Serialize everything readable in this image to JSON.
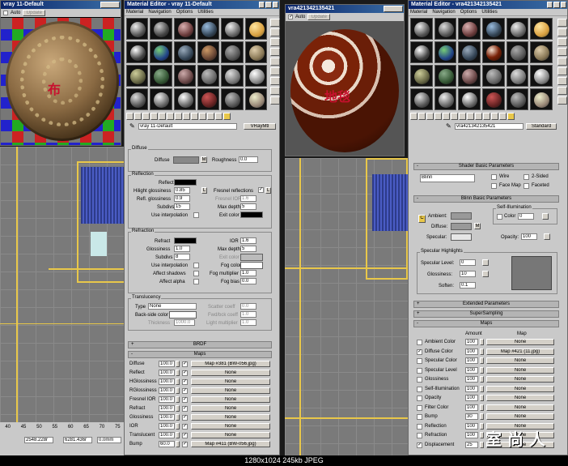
{
  "left_render": {
    "title": "vray 11-Default",
    "auto_label": "Auto",
    "update_label": "Update",
    "caption": "布"
  },
  "middle_render": {
    "title": "vra421342135421",
    "auto_label": "Auto",
    "update_label": "Update",
    "caption": "地毯"
  },
  "menus": [
    "Material",
    "Navigation",
    "Options",
    "Utilities"
  ],
  "editor_left": {
    "title": "Material Editor - vray 11-Default",
    "material_name": "vray 11-Default",
    "material_type": "VRayMtl",
    "diffuse": {
      "header": "Diffuse",
      "diffuse_label": "Diffuse",
      "m_label": "M",
      "roughness_label": "Roughness",
      "roughness": "0.0"
    },
    "reflection": {
      "header": "Reflection",
      "reflect_label": "Reflect",
      "hilight_label": "Hilight glossiness",
      "hilight": "0.85",
      "l_label": "L",
      "fresnel_label": "Fresnel reflections",
      "fresnel_l": "L",
      "refl_gloss_label": "Refl. glossiness",
      "refl_gloss": "0.9",
      "fresnel_ior_label": "Fresnel IOR",
      "fresnel_ior": "1.6",
      "subdivs_label": "Subdivs",
      "subdivs": "15",
      "max_depth_label": "Max depth",
      "max_depth": "5",
      "use_interp_label": "Use interpolation",
      "exit_color_label": "Exit color"
    },
    "refraction": {
      "header": "Refraction",
      "refract_label": "Refract",
      "ior_label": "IOR",
      "ior": "1.6",
      "glossiness_label": "Glossiness",
      "glossiness": "1.0",
      "max_depth_label": "Max depth",
      "max_depth": "5",
      "subdivs_label": "Subdivs",
      "subdivs": "8",
      "exit_color_label": "Exit color",
      "use_interp_label": "Use interpolation",
      "fog_color_label": "Fog color",
      "affect_shadows_label": "Affect shadows",
      "fog_mult_label": "Fog multiplier",
      "fog_mult": "1.0",
      "affect_alpha_label": "Affect alpha",
      "fog_bias_label": "Fog bias",
      "fog_bias": "0.0"
    },
    "translucency": {
      "header": "Translucency",
      "type_label": "Type",
      "type_value": "None",
      "scatter_label": "Scatter coeff",
      "scatter": "0.0",
      "backside_label": "Back-side color",
      "fwd_label": "Fwd/bck coeff",
      "fwd": "1.0",
      "thickness_label": "Thickness",
      "thickness": "1000.0",
      "light_mult_label": "Light multiplier",
      "light_mult": "1.0"
    },
    "brdf_label": "BRDF",
    "maps_label": "Maps",
    "maps": [
      {
        "name": "Diffuse",
        "amount": "100.0",
        "map": "Map #381 (BW-056.jpg)",
        "checked": "✓"
      },
      {
        "name": "Reflect",
        "amount": "100.0",
        "map": "None",
        "checked": "✓"
      },
      {
        "name": "HGlossiness",
        "amount": "100.0",
        "map": "None",
        "checked": "✓"
      },
      {
        "name": "RGlossiness",
        "amount": "100.0",
        "map": "None",
        "checked": "✓"
      },
      {
        "name": "Fresnel IOR",
        "amount": "100.0",
        "map": "None",
        "checked": "✓"
      },
      {
        "name": "Refract",
        "amount": "100.0",
        "map": "None",
        "checked": "✓"
      },
      {
        "name": "Glossiness",
        "amount": "100.0",
        "map": "None",
        "checked": "✓"
      },
      {
        "name": "IOR",
        "amount": "100.0",
        "map": "None",
        "checked": "✓"
      },
      {
        "name": "Translucent",
        "amount": "100.0",
        "map": "None",
        "checked": "✓"
      },
      {
        "name": "Bump",
        "amount": "60.0",
        "map": "Map #411 (BW-056.jpg)",
        "checked": "✓"
      }
    ]
  },
  "editor_right": {
    "title": "Material Editor - vra421342135421",
    "material_name": "vra421342135421",
    "material_type": "Standard",
    "shader_header": "Shader Basic Parameters",
    "shader": "Blinn",
    "wire_label": "Wire",
    "two_sided_label": "2-Sided",
    "face_map_label": "Face Map",
    "faceted_label": "Faceted",
    "blinn_header": "Blinn Basic Parameters",
    "self_illum_label": "Self-Illumination",
    "color_label": "Color",
    "color_value": "0",
    "ambient_label": "Ambient:",
    "diffuse_label": "Diffuse:",
    "specular_label": "Specular:",
    "m_label": "M",
    "opacity_label": "Opacity:",
    "opacity": "100",
    "spec_header": "Specular Highlights",
    "spec_level_label": "Specular Level:",
    "spec_level": "0",
    "gloss_label": "Glossiness:",
    "gloss": "10",
    "soften_label": "Soften:",
    "soften": "0.1",
    "extended_label": "Extended Parameters",
    "supersampling_label": "SuperSampling",
    "maps_label": "Maps",
    "amount_header": "Amount",
    "map_header": "Map",
    "maps": [
      {
        "name": "Ambient Color",
        "amount": "100",
        "map": "None",
        "checked": ""
      },
      {
        "name": "Diffuse Color",
        "amount": "100",
        "map": "Map #421 (11.jpg)",
        "checked": "✓"
      },
      {
        "name": "Specular Color",
        "amount": "100",
        "map": "None",
        "checked": ""
      },
      {
        "name": "Specular Level",
        "amount": "100",
        "map": "None",
        "checked": ""
      },
      {
        "name": "Glossiness",
        "amount": "100",
        "map": "None",
        "checked": ""
      },
      {
        "name": "Self-Illumination",
        "amount": "100",
        "map": "None",
        "checked": ""
      },
      {
        "name": "Opacity",
        "amount": "100",
        "map": "None",
        "checked": ""
      },
      {
        "name": "Filter Color",
        "amount": "100",
        "map": "None",
        "checked": ""
      },
      {
        "name": "Bump",
        "amount": "30",
        "map": "None",
        "checked": ""
      },
      {
        "name": "Reflection",
        "amount": "100",
        "map": "None",
        "checked": ""
      },
      {
        "name": "Refraction",
        "amount": "100",
        "map": "None",
        "checked": ""
      },
      {
        "name": "Displacement",
        "amount": "25",
        "map": "None",
        "checked": "✓"
      }
    ]
  },
  "status": {
    "x": "2548.228r",
    "y": "6281.436r",
    "z": "0.0mm"
  },
  "ruler": [
    "40",
    "45",
    "50",
    "55",
    "60",
    "65",
    "70",
    "75"
  ],
  "watermark": "室 尚 人",
  "footer": "1280x1024  245kb  JPEG"
}
